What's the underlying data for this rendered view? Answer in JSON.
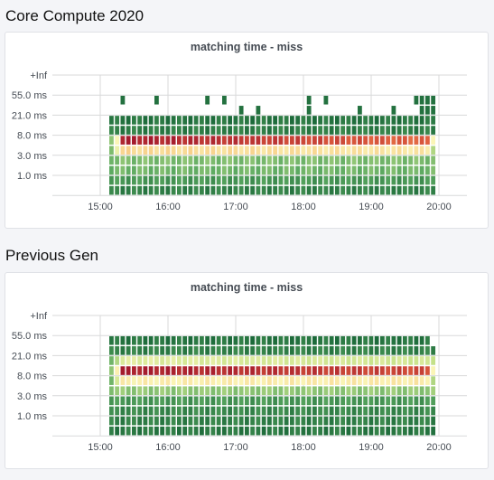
{
  "sections": [
    {
      "title": "Core Compute 2020",
      "panel_title": "matching time - miss",
      "chart_data": {
        "type": "heatmap",
        "y_buckets": [
          "+Inf",
          "55.0 ms",
          "21.0 ms",
          "8.0 ms",
          "3.0 ms",
          "1.0 ms"
        ],
        "x_ticks": [
          "15:00",
          "16:00",
          "17:00",
          "18:00",
          "19:00",
          "20:00"
        ],
        "x_start": "15:10",
        "x_end": "19:55",
        "interval_minutes": 5,
        "rows_top_to_bottom": [
          {
            "levels": [
              0.03,
              0.03
            ]
          },
          {
            "levels": [
              0.05,
              0.05
            ]
          },
          {
            "levels": [
              1.0,
              0.82
            ],
            "first": [
              0.25,
              0.5
            ],
            "last": 0.5
          },
          {
            "levels": [
              0.6,
              0.55
            ],
            "first": [
              0.22,
              0.45
            ],
            "last": 0.3
          },
          {
            "levels": [
              0.22,
              0.22
            ]
          },
          {
            "levels": [
              0.2,
              0.2
            ]
          },
          {
            "levels": [
              0.12,
              0.12
            ]
          },
          {
            "levels": [
              0.06,
              0.06
            ]
          }
        ],
        "sparse_upper": [
          2,
          8,
          17,
          20,
          35,
          38,
          54,
          55,
          56,
          57
        ],
        "sparse_lower": [
          23,
          26,
          35,
          44,
          50,
          55,
          56,
          57
        ],
        "color_scale": [
          "#1c6a3a",
          "#5aa860",
          "#c6e28a",
          "#faf5b6",
          "#f6c27a",
          "#df5e3d",
          "#a41b2d"
        ]
      }
    },
    {
      "title": "Previous Gen",
      "panel_title": "matching time - miss",
      "chart_data": {
        "type": "heatmap",
        "y_buckets": [
          "+Inf",
          "55.0 ms",
          "21.0 ms",
          "8.0 ms",
          "3.0 ms",
          "1.0 ms"
        ],
        "x_ticks": [
          "15:00",
          "16:00",
          "17:00",
          "18:00",
          "19:00",
          "20:00"
        ],
        "x_start": "15:10",
        "x_end": "19:55",
        "interval_minutes": 5,
        "rows_top_to_bottom": [
          {
            "levels": [
              0.03,
              0.03
            ],
            "missing_last": true
          },
          {
            "levels": [
              0.06,
              0.06
            ]
          },
          {
            "levels": [
              0.42,
              0.36
            ],
            "first": [
              0.2,
              0.3
            ]
          },
          {
            "levels": [
              1.0,
              0.88
            ],
            "first": [
              0.25,
              0.52
            ],
            "last": 0.5
          },
          {
            "levels": [
              0.52,
              0.54
            ],
            "first": [
              0.2,
              0.38
            ],
            "last": 0.3
          },
          {
            "levels": [
              0.25,
              0.25
            ]
          },
          {
            "levels": [
              0.12,
              0.12
            ]
          },
          {
            "levels": [
              0.08,
              0.08
            ]
          },
          {
            "levels": [
              0.06,
              0.06
            ]
          },
          {
            "levels": [
              0.04,
              0.04
            ]
          }
        ],
        "sparse_upper": [],
        "sparse_lower": [],
        "color_scale": [
          "#1c6a3a",
          "#5aa860",
          "#c6e28a",
          "#faf5b6",
          "#f6c27a",
          "#df5e3d",
          "#a41b2d"
        ]
      }
    }
  ]
}
